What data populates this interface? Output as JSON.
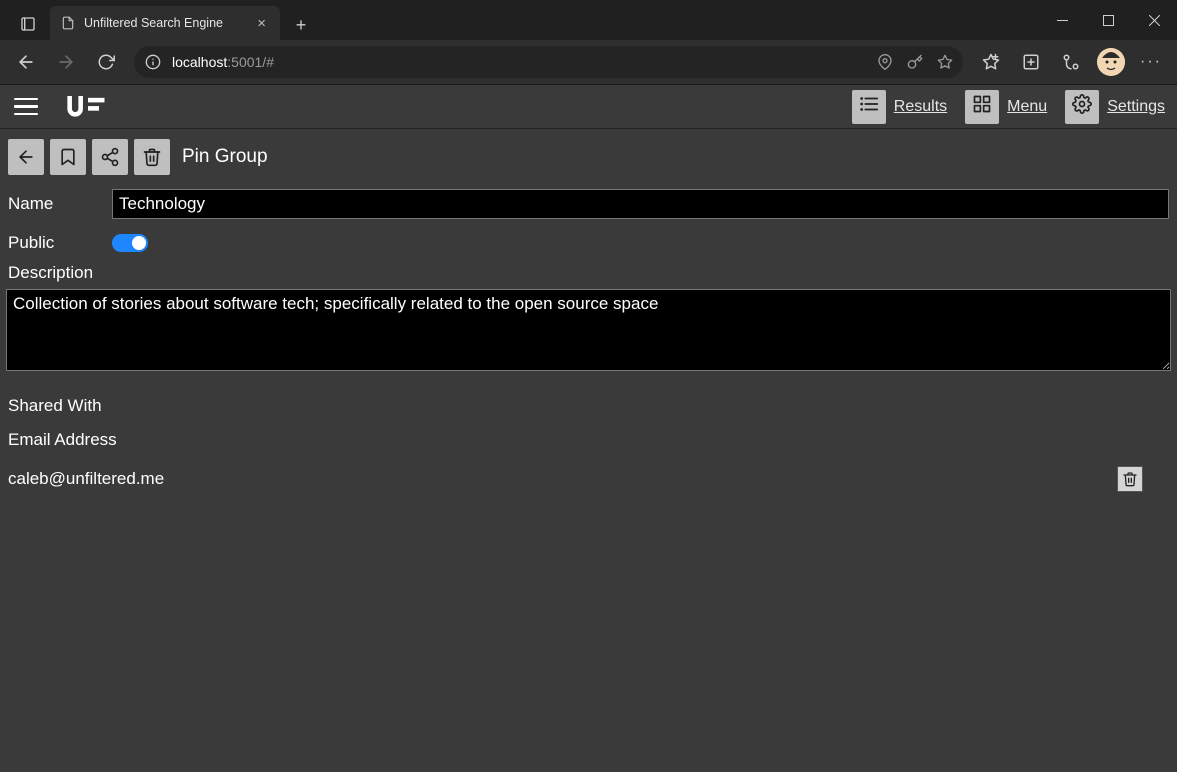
{
  "browser": {
    "tab_title": "Unfiltered Search Engine",
    "url_host": "localhost",
    "url_rest": ":5001/#"
  },
  "header": {
    "logo_text": "UF",
    "results_label": "Results",
    "menu_label": "Menu",
    "settings_label": "Settings"
  },
  "toolbar": {
    "page_title": "Pin Group"
  },
  "form": {
    "name_label": "Name",
    "name_value": "Technology",
    "public_label": "Public",
    "public_value": true,
    "description_label": "Description",
    "description_value": "Collection of stories about software tech; specifically related to the open source space"
  },
  "shared": {
    "section_label": "Shared With",
    "column_label": "Email Address",
    "rows": [
      {
        "email": "caleb@unfiltered.me"
      }
    ]
  }
}
